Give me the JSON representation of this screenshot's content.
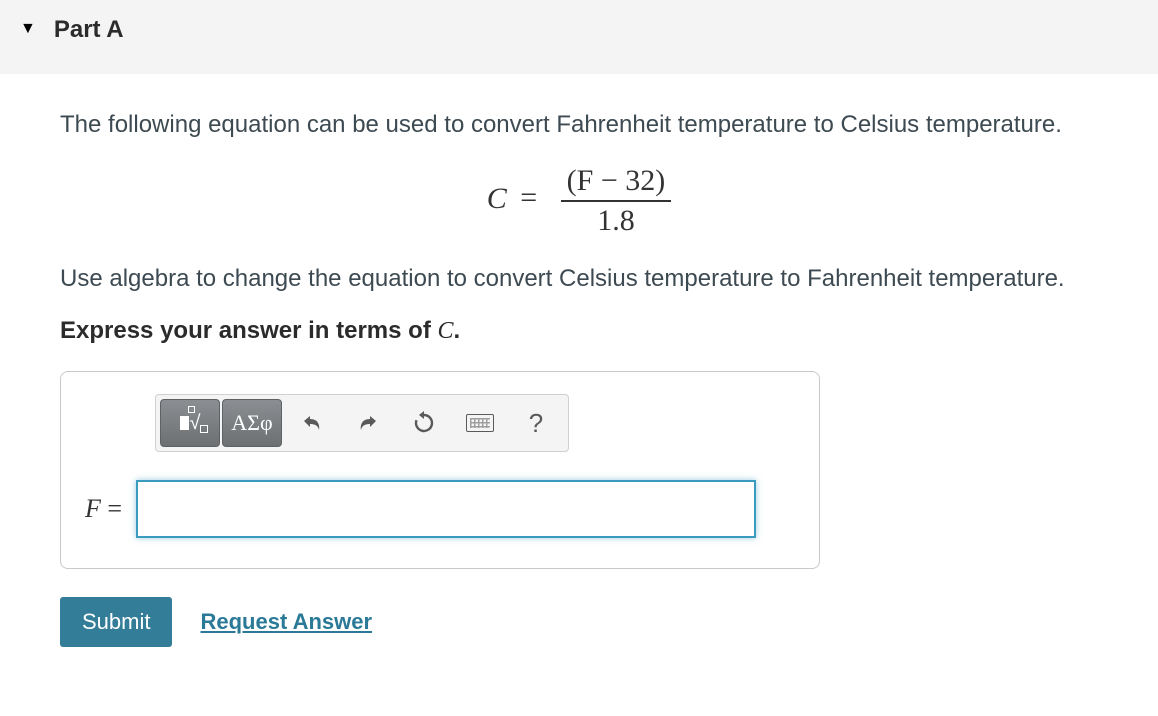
{
  "header": {
    "part_label": "Part A"
  },
  "prompt": {
    "intro": "The following equation can be used to convert Fahrenheit temperature to Celsius temperature.",
    "equation": {
      "lhs": "C",
      "eq": "=",
      "numerator": "(F − 32)",
      "denominator": "1.8"
    },
    "task": "Use algebra to change the equation to convert Celsius temperature to Fahrenheit temperature.",
    "instruction_prefix": "Express your answer in terms of ",
    "instruction_var": "C",
    "instruction_suffix": "."
  },
  "toolbar": {
    "templates_label": "templates",
    "greek_label": "ΑΣφ",
    "undo": "undo",
    "redo": "redo",
    "reset": "reset",
    "keyboard": "keyboard",
    "help": "?"
  },
  "answer": {
    "lhs": "F",
    "equals": " =",
    "value": "",
    "placeholder": ""
  },
  "actions": {
    "submit": "Submit",
    "request": "Request Answer"
  }
}
